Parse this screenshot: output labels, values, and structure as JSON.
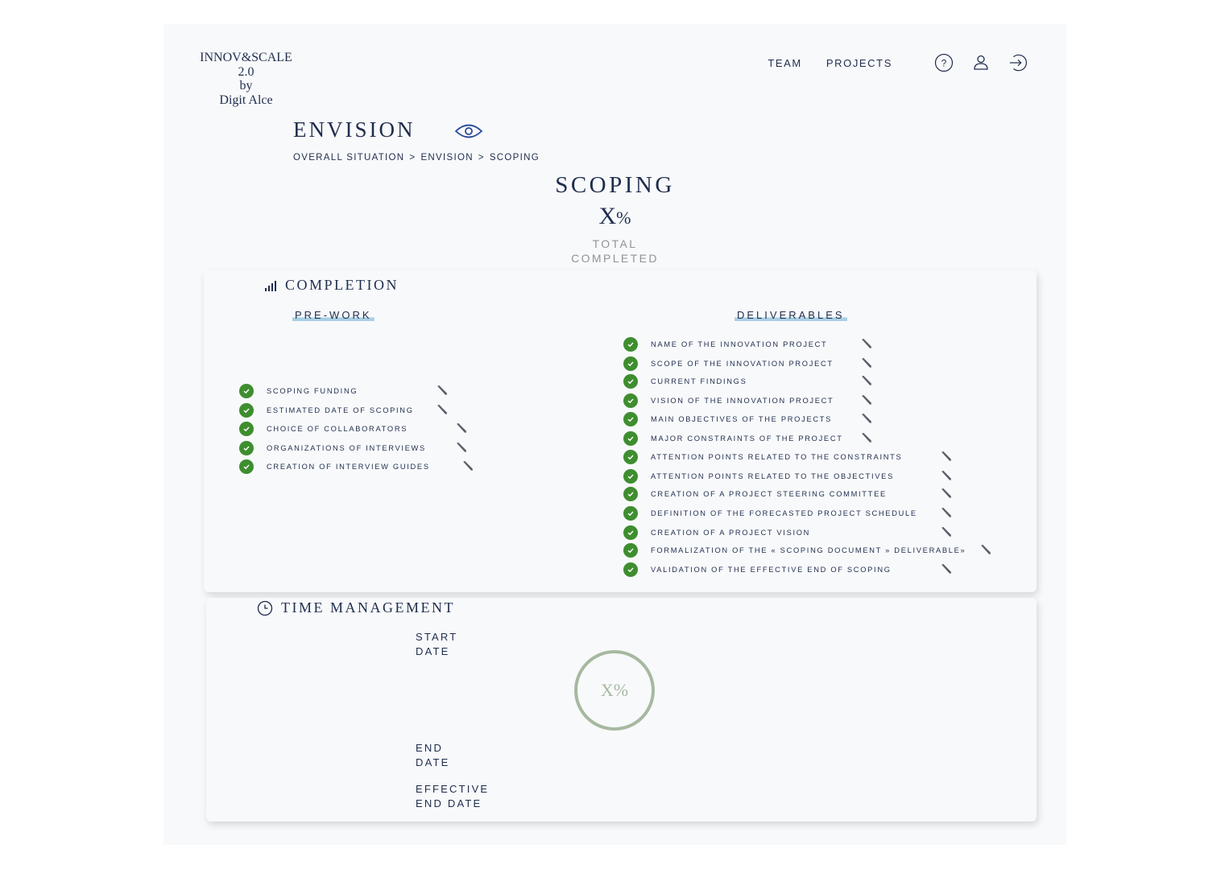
{
  "brand": {
    "line1": "INNOV&SCALE 2.0",
    "line2": "by",
    "line3": "Digit Alce"
  },
  "nav": {
    "team": "TEAM",
    "projects": "PROJECTS",
    "help_icon": "help-circle-icon",
    "user_icon": "user-icon",
    "logout_icon": "logout-icon"
  },
  "page": {
    "title": "ENVISION",
    "title_icon": "eye-icon",
    "breadcrumb": [
      "OVERALL SITUATION",
      "ENVISION",
      "SCOPING"
    ],
    "breadcrumb_sep": ">"
  },
  "scoping": {
    "title": "SCOPING",
    "percent": "X",
    "percent_sign": "%",
    "sub1": "TOTAL",
    "sub2": "COMPLETED"
  },
  "completion": {
    "title": "COMPLETION",
    "icon": "signal-bars-icon",
    "prework": {
      "title": "PRE-WORK",
      "items": [
        "SCOPING FUNDING",
        "ESTIMATED DATE OF SCOPING",
        "CHOICE OF COLLABORATORS",
        "ORGANIZATIONS OF INTERVIEWS",
        "CREATION OF INTERVIEW GUIDES"
      ]
    },
    "deliverables": {
      "title": "DELIVERABLES",
      "items": [
        "NAME OF THE INNOVATION PROJECT",
        "SCOPE OF THE INNOVATION PROJECT",
        "CURRENT FINDINGS",
        "VISION OF THE INNOVATION PROJECT",
        "MAIN OBJECTIVES OF THE PROJECTS",
        "MAJOR CONSTRAINTS OF THE PROJECT",
        "ATTENTION POINTS RELATED TO THE CONSTRAINTS",
        "ATTENTION POINTS RELATED TO THE OBJECTIVES",
        "CREATION OF A PROJECT STEERING COMMITTEE",
        "DEFINITION OF THE FORECASTED PROJECT SCHEDULE",
        "CREATION OF A PROJECT VISION",
        "FORMALIZATION OF THE « SCOPING DOCUMENT » DELIVERABLE»",
        "VALIDATION OF THE EFFECTIVE END OF SCOPING"
      ]
    },
    "item_icon": "check-circle-icon",
    "edit_icon": "pencil-icon"
  },
  "time_management": {
    "title": "TIME MANAGEMENT",
    "icon": "clock-icon",
    "start_date": [
      "START",
      "DATE"
    ],
    "end_date": [
      "END",
      "DATE"
    ],
    "effective_end_date": [
      "EFFECTIVE",
      "END DATE"
    ],
    "progress": "X%"
  },
  "colors": {
    "text": "#1f2d4d",
    "check": "#3e8e2f",
    "underline": "#a9cfe3",
    "ring": "#a6b9a0",
    "muted": "#8f9398"
  }
}
